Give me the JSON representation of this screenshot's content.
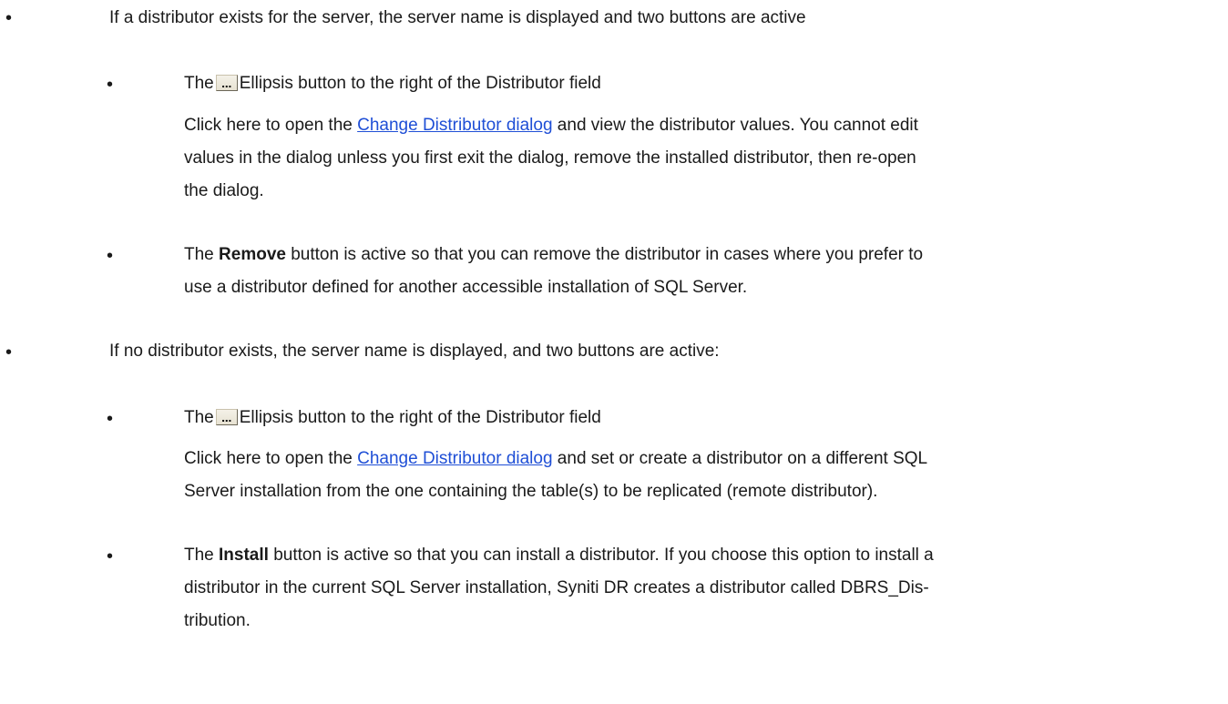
{
  "bullet_glyph": "•",
  "items": [
    {
      "text": "If a distributor exists for the server, the server name is displayed and two buttons are active",
      "sub": [
        {
          "pre": "The",
          "icon": "ellipsis-button-icon",
          "post": "Ellipsis button to the right of the Distributor field",
          "desc_pre": " Click here to open the ",
          "link": "Change Distributor dialog",
          "desc_line1_post": " and view the distributor values.  You cannot edit",
          "desc_line2": "values in the dialog unless you first exit the dialog, remove the installed distributor, then re-open",
          "desc_line3": "the dialog."
        },
        {
          "pre": "The ",
          "bold": "Remove",
          "post_line1": " button is active so that you can remove the distributor in cases where you prefer to",
          "line2": "use a distributor defined for another accessible installation of SQL Server."
        }
      ]
    },
    {
      "text": "If no distributor exists, the server name is displayed, and two buttons are active:",
      "sub": [
        {
          "pre": "The",
          "icon": "ellipsis-button-icon",
          "post": "Ellipsis button to the right of the Distributor field",
          "desc_pre": " Click here to open the ",
          "link": "Change Distributor dialog",
          "desc_line1_post": " and set or create a distributor on a different SQL",
          "desc_line2": "Server installation from the one containing the table(s) to be replicated (remote distributor)."
        },
        {
          "pre": "The ",
          "bold": "Install",
          "post_line1": " button is active so that you can install a distributor. If you choose this option to install a",
          "line2": "distributor in the current SQL Server installation, Syniti DR creates a distributor called DBRS_Dis-",
          "line3": "tribution."
        }
      ]
    }
  ],
  "colors": {
    "text": "#1a1a1a",
    "link": "#1f4fd6",
    "background": "#ffffff"
  }
}
